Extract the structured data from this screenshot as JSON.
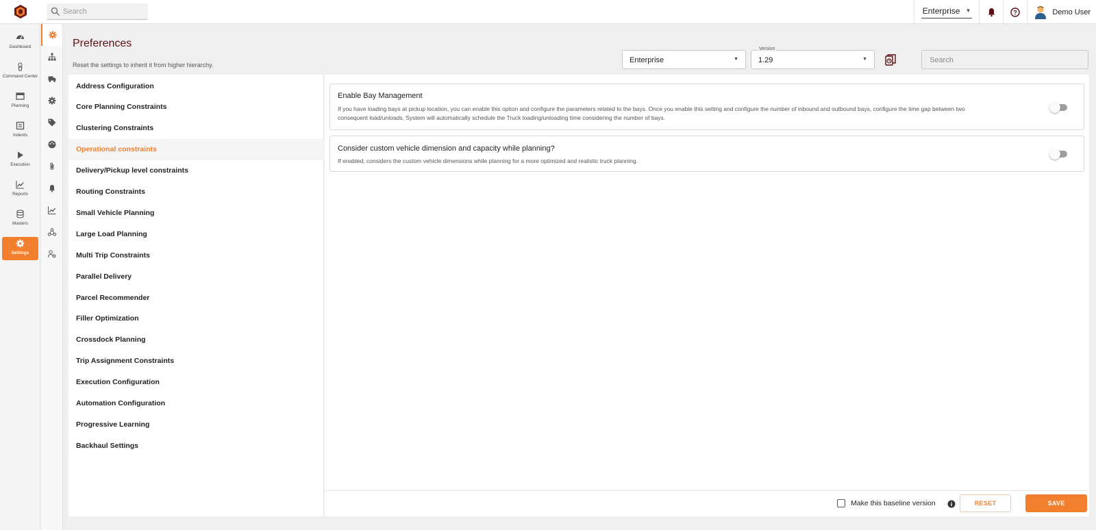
{
  "topbar": {
    "search_placeholder": "Search",
    "org_selector": "Enterprise",
    "user_name": "Demo User"
  },
  "nav": {
    "items": [
      {
        "label": "Dashboard",
        "icon": "dashboard-icon"
      },
      {
        "label": "Command Center",
        "icon": "command-center-icon"
      },
      {
        "label": "Planning",
        "icon": "planning-icon"
      },
      {
        "label": "Indents",
        "icon": "indents-icon"
      },
      {
        "label": "Execution",
        "icon": "execution-icon"
      },
      {
        "label": "Reports",
        "icon": "reports-icon"
      },
      {
        "label": "Masters",
        "icon": "masters-icon"
      },
      {
        "label": "Settings",
        "icon": "settings-icon",
        "active": true
      }
    ]
  },
  "subnav": {
    "icons": [
      "preferences-gear-icon",
      "hierarchy-icon",
      "truck-icon",
      "cog-icon",
      "tag-icon",
      "palette-icon",
      "attachment-icon",
      "bell-icon",
      "chart-icon",
      "network-icon",
      "user-settings-icon"
    ]
  },
  "header": {
    "title": "Preferences",
    "subtitle": "Reset the settings to inherit it from higher hierarchy.",
    "level_select": "Enterprise",
    "version_label": "Version",
    "version_select": "1.29",
    "search_placeholder": "Search"
  },
  "sections": [
    "Address Configuration",
    "Core Planning Constraints",
    "Clustering Constraints",
    "Operational constraints",
    "Delivery/Pickup level constraints",
    "Routing Constraints",
    "Small Vehicle Planning",
    "Large Load Planning",
    "Multi Trip Constraints",
    "Parallel Delivery",
    "Parcel Recommender",
    "Filler Optimization",
    "Crossdock Planning",
    "Trip Assignment Constraints",
    "Execution Configuration",
    "Automation Configuration",
    "Progressive Learning",
    "Backhaul Settings"
  ],
  "active_section": "Operational constraints",
  "settings": [
    {
      "title": "Enable Bay Management",
      "description": "If you have loading bays at pickup location, you can enable this option and configure the parameters related to the bays. Once you enable this setting and configure the number of inbound and outbound bays, configure the time gap between two consequent load/unloads, System will automatically schedule the Truck loading/unloading time considering the number of bays.",
      "enabled": false
    },
    {
      "title": "Consider custom vehicle dimension and capacity while planning?",
      "description": "If enabled, considers the custom vehicle dimensions while planning for a more optimized and realistic truck planning.",
      "enabled": false
    }
  ],
  "footer": {
    "baseline_label": "Make this baseline version",
    "reset_label": "RESET",
    "save_label": "SAVE"
  },
  "colors": {
    "accent": "#f27f2e",
    "title": "#5c0f14"
  }
}
